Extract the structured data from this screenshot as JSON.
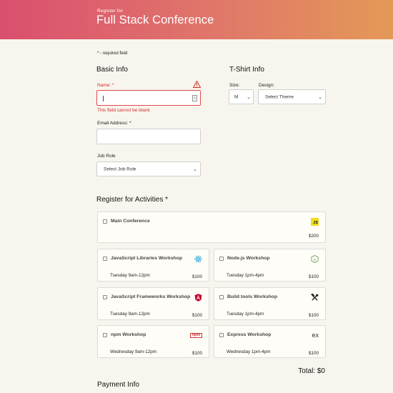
{
  "header": {
    "pre_title": "Register for",
    "title": "Full Stack Conference"
  },
  "required_note": "* - required field",
  "basic_info": {
    "title": "Basic Info",
    "name": {
      "label": "Name: *",
      "value": "",
      "error": "This field cannot be blank"
    },
    "email": {
      "label": "Email Address: *",
      "value": ""
    },
    "job_role": {
      "label": "Job Role",
      "selected": "Select Job Role"
    }
  },
  "tshirt": {
    "title": "T-Shirt Info",
    "size": {
      "label": "Size:",
      "selected": "M"
    },
    "design": {
      "label": "Design:",
      "selected": "Select Theme"
    }
  },
  "activities": {
    "title": "Register for Activities *",
    "items": [
      {
        "name": "Main Conference",
        "when": "",
        "price": "$200",
        "icon": "js-icon",
        "icon_text": "JS"
      },
      {
        "name": "JavaScript Libraries Workshop",
        "when": "Tuesday 9am-12pm",
        "price": "$100",
        "icon": "react-icon"
      },
      {
        "name": "Node.js Workshop",
        "when": "Tuesday 1pm-4pm",
        "price": "$100",
        "icon": "nodejs-icon"
      },
      {
        "name": "JavaScript Frameworks Workshop",
        "when": "Tuesday 9am-12pm",
        "price": "$100",
        "icon": "angular-icon"
      },
      {
        "name": "Build tools Workshop",
        "when": "Tuesday 1pm-4pm",
        "price": "$100",
        "icon": "tools-icon"
      },
      {
        "name": "npm Workshop",
        "when": "Wednesday 9am-12pm",
        "price": "$100",
        "icon": "npm-icon",
        "icon_text": "npm"
      },
      {
        "name": "Express Workshop",
        "when": "Wednesday 1pm-4pm",
        "price": "$100",
        "icon": "express-icon",
        "icon_text": "ex"
      }
    ],
    "total": "Total: $0"
  },
  "payment": {
    "title": "Payment Info"
  },
  "colors": {
    "header_start": "#da4f6f",
    "header_end": "#e49957",
    "error": "#d62b2b",
    "background": "#f8f5ee"
  }
}
